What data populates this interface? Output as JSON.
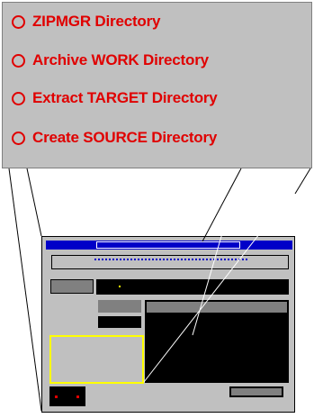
{
  "zoom_options": [
    {
      "label": "ZIPMGR Directory"
    },
    {
      "label": "Archive WORK Directory"
    },
    {
      "label": "Extract TARGET Directory"
    },
    {
      "label": "Create SOURCE Directory"
    }
  ],
  "colors": {
    "accent": "#e00000",
    "titlebar": "#0000c8",
    "highlight": "#ffff00",
    "panel": "#c0c0c0"
  }
}
